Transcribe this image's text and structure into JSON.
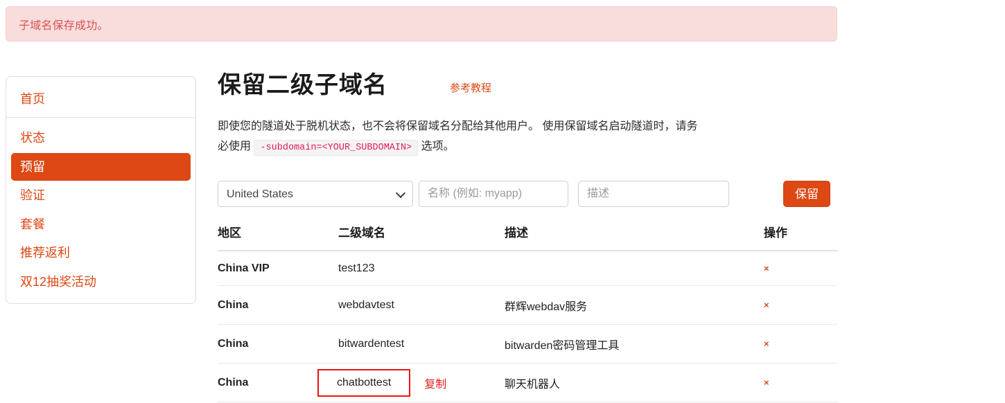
{
  "alert": {
    "message": "子域名保存成功。",
    "bg_color": "#f9dddd",
    "text_color": "#d9534f"
  },
  "sidebar": {
    "home_label": "首页",
    "items": [
      {
        "label": "状态",
        "active": false
      },
      {
        "label": "预留",
        "active": true
      },
      {
        "label": "验证",
        "active": false
      },
      {
        "label": "套餐",
        "active": false
      },
      {
        "label": "推荐返利",
        "active": false
      },
      {
        "label": "双12抽奖活动",
        "active": false
      }
    ],
    "accent_color": "#dd4814"
  },
  "main": {
    "title": "保留二级子域名",
    "tutorial_link": "参考教程",
    "intro_part1": "即使您的隧道处于脱机状态，也不会将保留域名分配给其他用户。 使用保留域名启动隧道时，请务必使用",
    "intro_code": "-subdomain=<YOUR_SUBDOMAIN>",
    "intro_part2": "选项。"
  },
  "form": {
    "region_selected": "United States",
    "region_options": [
      "United States"
    ],
    "name_placeholder": "名称 (例如: myapp)",
    "name_value": "",
    "desc_placeholder": "描述",
    "desc_value": "",
    "submit_label": "保留",
    "submit_color": "#dd4814"
  },
  "table": {
    "headers": [
      "地区",
      "二级域名",
      "描述",
      "操作"
    ],
    "rows": [
      {
        "region": "China VIP",
        "subdomain": "test123",
        "description": "",
        "action": "×",
        "highlighted": false,
        "copy_label": ""
      },
      {
        "region": "China",
        "subdomain": "webdavtest",
        "description": "群辉webdav服务",
        "action": "×",
        "highlighted": false,
        "copy_label": ""
      },
      {
        "region": "China",
        "subdomain": "bitwardentest",
        "description": "bitwarden密码管理工具",
        "action": "×",
        "highlighted": false,
        "copy_label": ""
      },
      {
        "region": "China",
        "subdomain": "chatbottest",
        "description": "聊天机器人",
        "action": "×",
        "highlighted": true,
        "copy_label": "复制"
      }
    ],
    "highlight_color": "#ee1111"
  }
}
